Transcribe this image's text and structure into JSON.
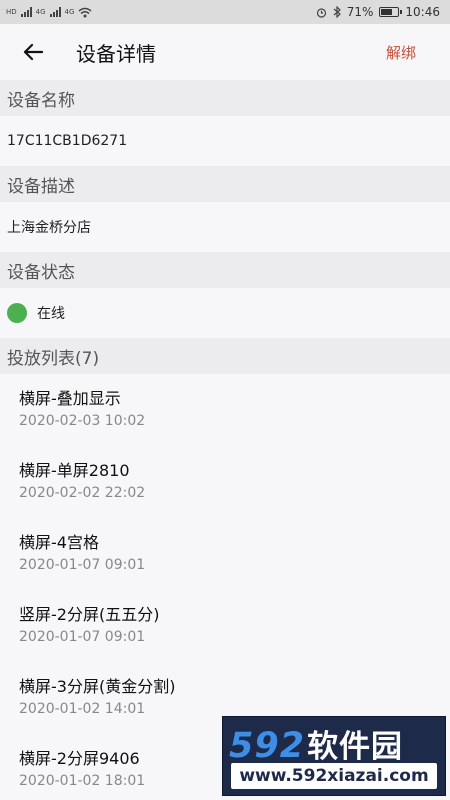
{
  "status_bar": {
    "left_labels": [
      "HD",
      "4G",
      "4G"
    ],
    "battery_percent": "71%",
    "battery_level": 0.71,
    "time": "10:46"
  },
  "app_bar": {
    "title": "设备详情",
    "action_label": "解绑"
  },
  "device": {
    "name_header": "设备名称",
    "name_value": "17C11CB1D6271",
    "desc_header": "设备描述",
    "desc_value": "上海金桥分店",
    "status_header": "设备状态",
    "status_value": "在线",
    "status_color": "#4caf50"
  },
  "playlist": {
    "header": "投放列表(7)",
    "items": [
      {
        "name": "横屏-叠加显示",
        "date": "2020-02-03 10:02"
      },
      {
        "name": "横屏-单屏2810",
        "date": "2020-02-02 22:02"
      },
      {
        "name": "横屏-4宫格",
        "date": "2020-01-07 09:01"
      },
      {
        "name": "竖屏-2分屏(五五分)",
        "date": "2020-01-07 09:01"
      },
      {
        "name": "横屏-3分屏(黄金分割)",
        "date": "2020-01-02 14:01"
      },
      {
        "name": "横屏-2分屏9406",
        "date": "2020-01-02 18:01"
      }
    ]
  },
  "watermark": {
    "number": "592",
    "brand": "软件园",
    "url": "www.592xiazai.com"
  },
  "colors": {
    "accent": "#c8503a",
    "section_bg": "#ececee",
    "page_bg": "#f7f7f9"
  }
}
